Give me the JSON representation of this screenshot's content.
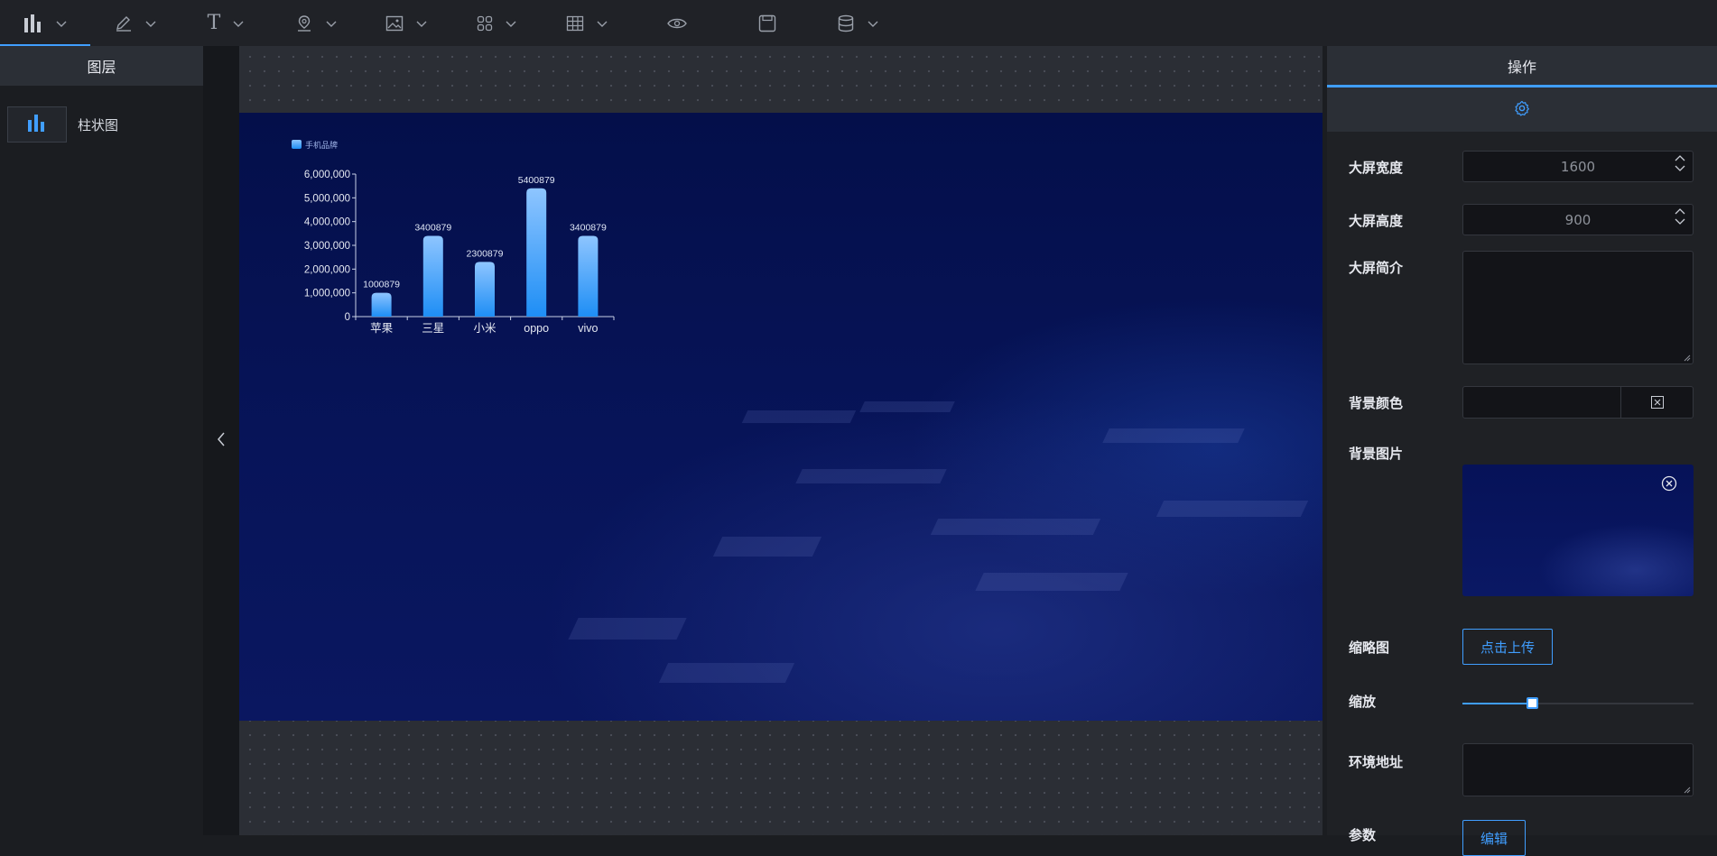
{
  "toolbar": {
    "tools": [
      {
        "icon": "bar-chart-icon",
        "has_dropdown": true,
        "active": true
      },
      {
        "icon": "pen-icon",
        "has_dropdown": true
      },
      {
        "icon": "text-icon",
        "has_dropdown": true
      },
      {
        "icon": "map-pin-icon",
        "has_dropdown": true
      },
      {
        "icon": "image-icon",
        "has_dropdown": true
      },
      {
        "icon": "grid-icon",
        "has_dropdown": true
      },
      {
        "icon": "table-icon",
        "has_dropdown": true
      },
      {
        "icon": "eye-icon",
        "has_dropdown": false
      },
      {
        "icon": "save-icon",
        "has_dropdown": false
      },
      {
        "icon": "database-icon",
        "has_dropdown": true
      }
    ],
    "text_glyph": "T"
  },
  "layers": {
    "title": "图层",
    "items": [
      {
        "label": "柱状图",
        "icon": "bar-chart-icon"
      }
    ]
  },
  "operation": {
    "title": "操作",
    "tab_icon": "gear-icon",
    "fields": {
      "width_label": "大屏宽度",
      "width_value": "1600",
      "height_label": "大屏高度",
      "height_value": "900",
      "intro_label": "大屏简介",
      "intro_value": "",
      "bg_color_label": "背景颜色",
      "bg_color_value": "",
      "bg_image_label": "背景图片",
      "thumbnail_label": "缩略图",
      "upload_label": "点击上传",
      "zoom_label": "缩放",
      "zoom_fraction": 0.3,
      "env_label": "环境地址",
      "env_value": "",
      "params_label": "参数",
      "edit_label": "编辑"
    }
  },
  "colors": {
    "accent": "#409eff",
    "bar_top": "#8ec5ff",
    "bar_bottom": "#1e8ef5"
  },
  "chart_data": {
    "type": "bar",
    "legend": [
      "手机品牌"
    ],
    "categories": [
      "苹果",
      "三星",
      "小米",
      "oppo",
      "vivo"
    ],
    "series": [
      {
        "name": "手机品牌",
        "values": [
          1000879,
          3400879,
          2300879,
          5400879,
          3400879
        ]
      }
    ],
    "data_labels": [
      "1000879",
      "3400879",
      "2300879",
      "5400879",
      "3400879"
    ],
    "ylim": [
      0,
      6000000
    ],
    "yticks": [
      0,
      1000000,
      2000000,
      3000000,
      4000000,
      5000000,
      6000000
    ],
    "ytick_labels": [
      "0",
      "1,000,000",
      "2,000,000",
      "3,000,000",
      "4,000,000",
      "5,000,000",
      "6,000,000"
    ],
    "grid": false,
    "legend_position": "top-left"
  }
}
